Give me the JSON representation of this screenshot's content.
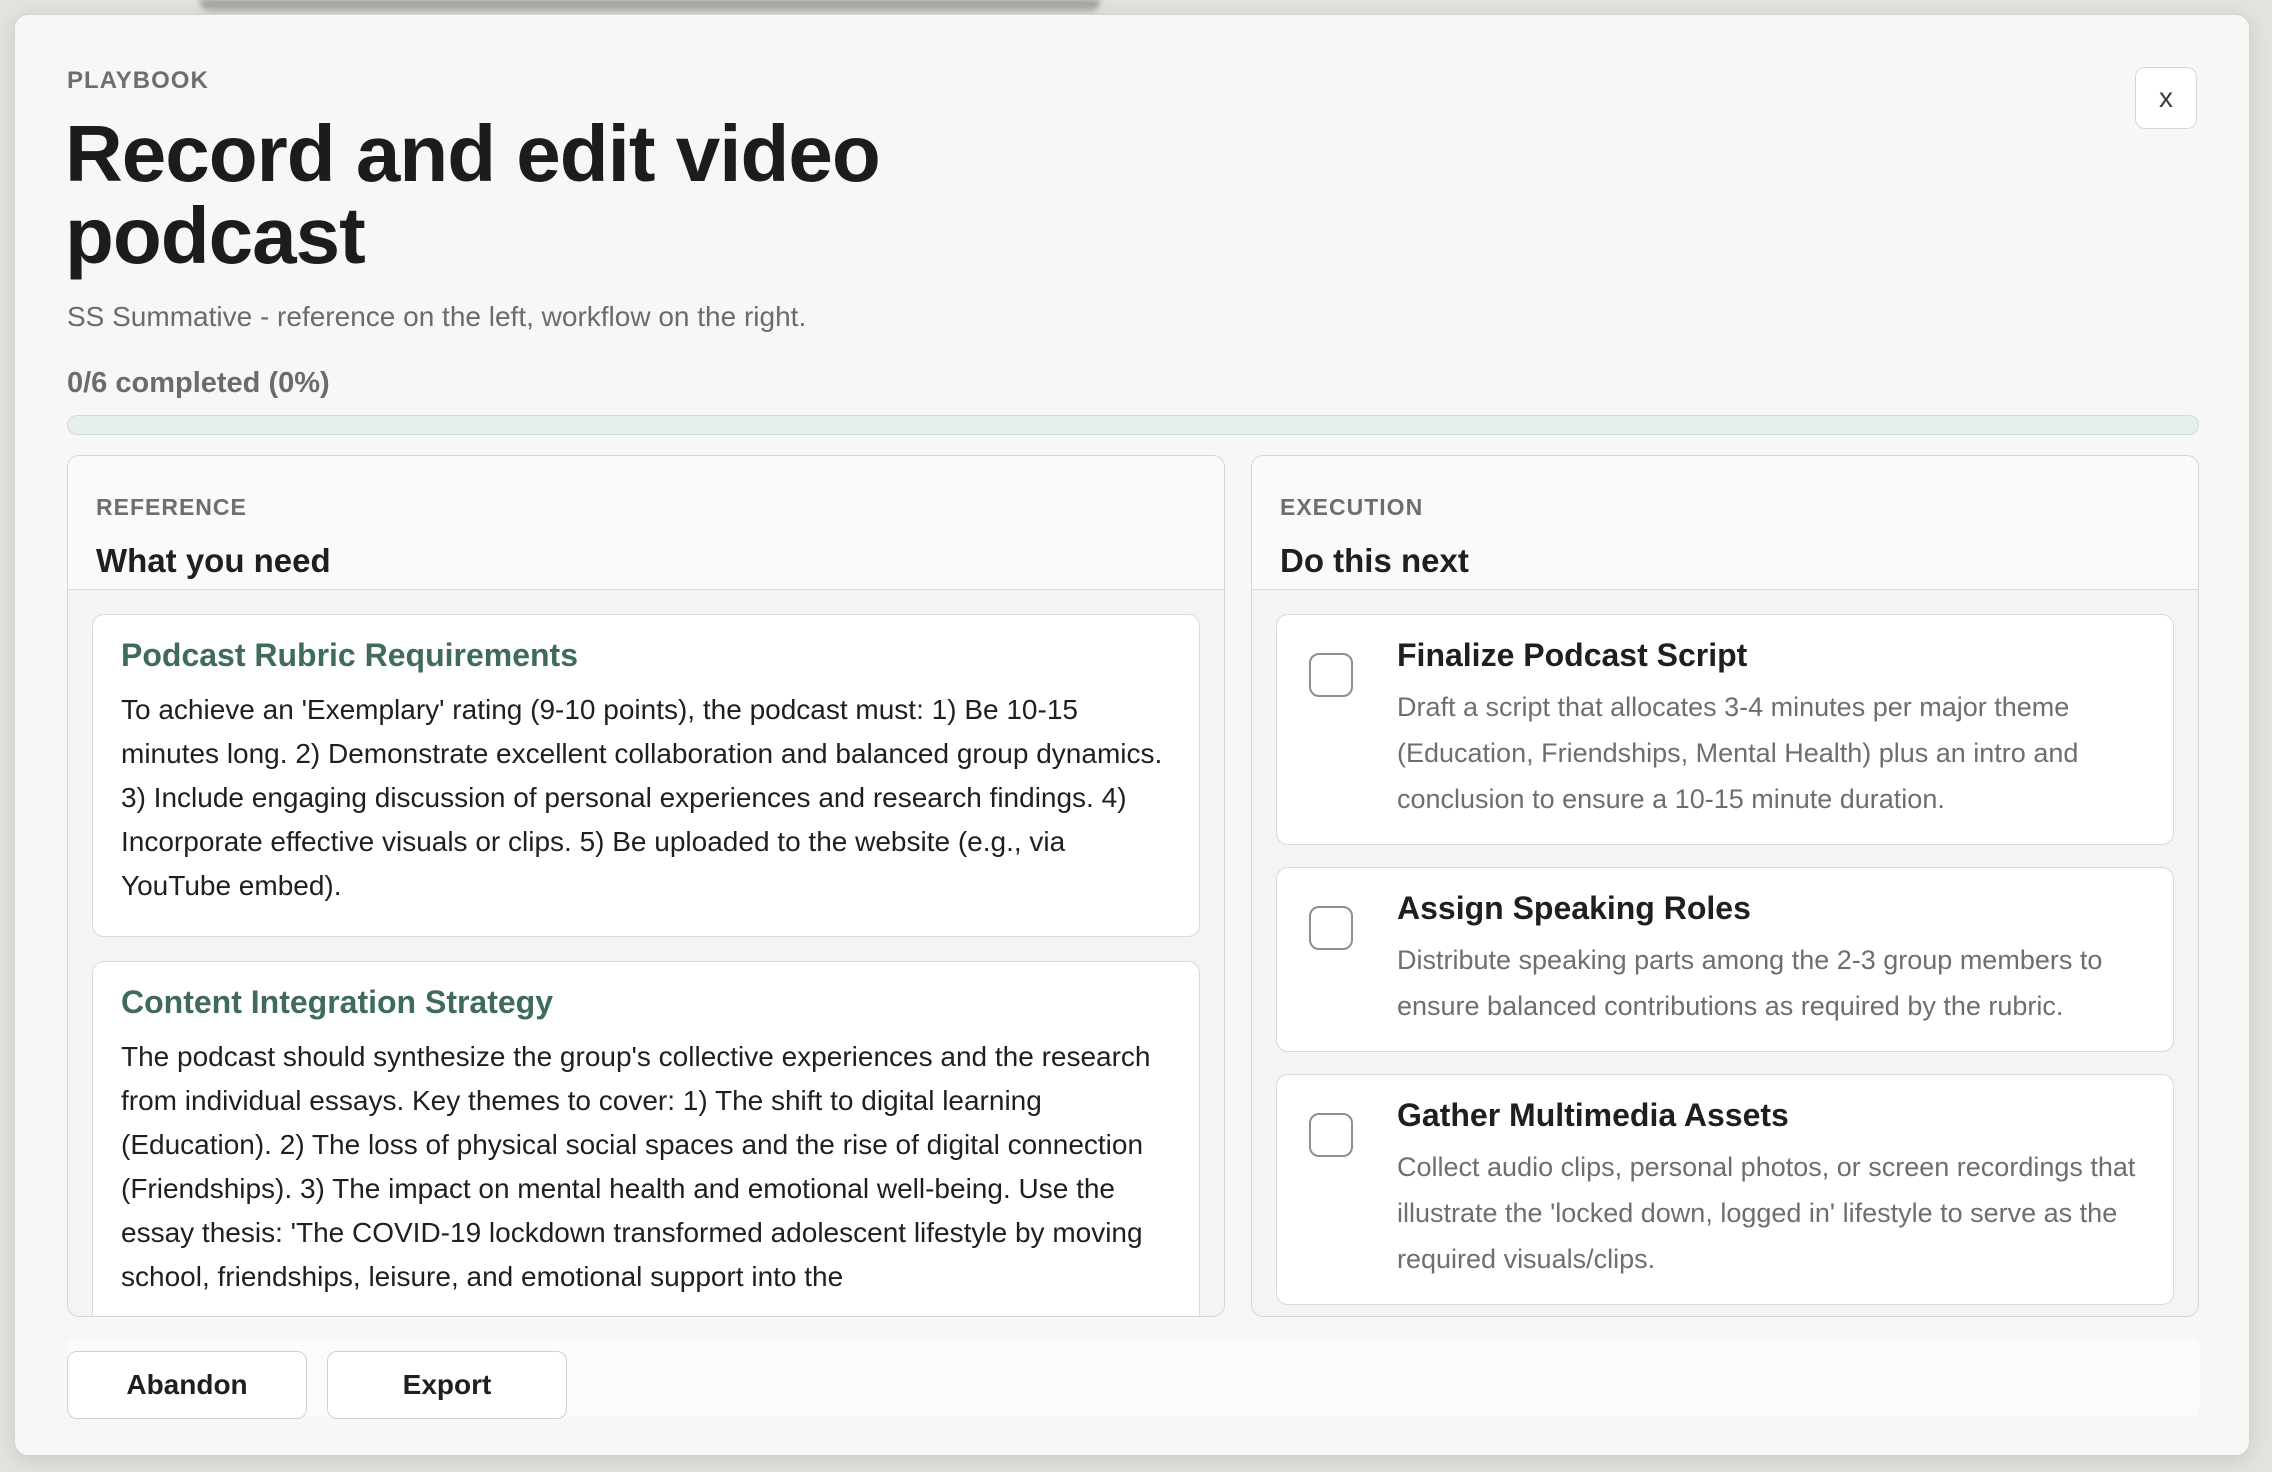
{
  "header": {
    "eyebrow": "PLAYBOOK",
    "title": "Record and edit video podcast",
    "subtitle": "SS Summative - reference on the left, workflow on the right.",
    "close_label": "x"
  },
  "progress": {
    "text": "0/6 completed (0%)",
    "completed": 0,
    "total": 6,
    "percent": 0,
    "fill_color": "#4d7a67"
  },
  "reference": {
    "eyebrow": "REFERENCE",
    "title": "What you need",
    "cards": [
      {
        "title": "Podcast Rubric Requirements",
        "text": "To achieve an 'Exemplary' rating (9-10 points), the podcast must: 1) Be 10-15 minutes long. 2) Demonstrate excellent collaboration and balanced group dynamics. 3) Include engaging discussion of personal experiences and research findings. 4) Incorporate effective visuals or clips. 5) Be uploaded to the website (e.g., via YouTube embed)."
      },
      {
        "title": "Content Integration Strategy",
        "text": "The podcast should synthesize the group's collective experiences and the research from individual essays. Key themes to cover: 1) The shift to digital learning (Education). 2) The loss of physical social spaces and the rise of digital connection (Friendships). 3) The impact on mental health and emotional well-being. Use the essay thesis: 'The COVID-19 lockdown transformed adolescent lifestyle by moving school, friendships, leisure, and emotional support into the"
      }
    ]
  },
  "execution": {
    "eyebrow": "EXECUTION",
    "title": "Do this next",
    "tasks": [
      {
        "title": "Finalize Podcast Script",
        "desc": "Draft a script that allocates 3-4 minutes per major theme (Education, Friendships, Mental Health) plus an intro and conclusion to ensure a 10-15 minute duration."
      },
      {
        "title": "Assign Speaking Roles",
        "desc": "Distribute speaking parts among the 2-3 group members to ensure balanced contributions as required by the rubric."
      },
      {
        "title": "Gather Multimedia Assets",
        "desc": "Collect audio clips, personal photos, or screen recordings that illustrate the 'locked down, logged in' lifestyle to serve as the required visuals/clips."
      }
    ]
  },
  "footer": {
    "abandon_label": "Abandon",
    "export_label": "Export"
  },
  "colors": {
    "accent": "#3f6b58",
    "background": "#f7f7f5"
  }
}
